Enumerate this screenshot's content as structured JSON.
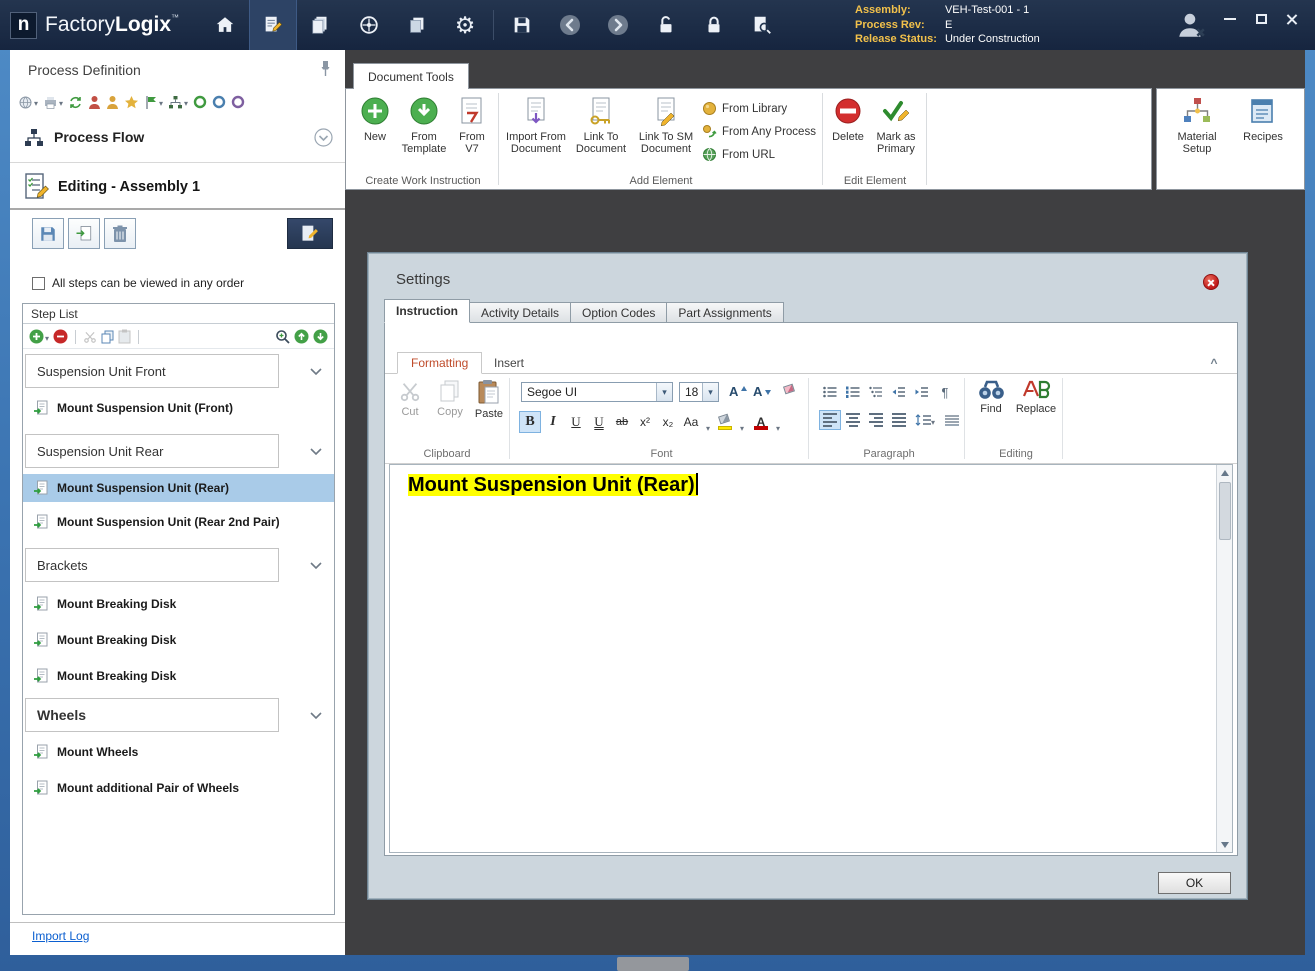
{
  "colors": {
    "titlebar_bg": "#1b2b47",
    "accent_yellow": "#f2c14b",
    "frame_blue": "#3a72b0",
    "selection_blue": "#a9cbe8",
    "highlight_yellow": "#ffff00",
    "main_bg": "#3f3f41",
    "dialog_bg": "#ccd6dd",
    "formatting_tab_text": "#bf4b2a"
  },
  "titlebar": {
    "logo_letter": "n",
    "brand_light": "Factory",
    "brand_bold": "Logix",
    "tm": "™",
    "info": {
      "assembly_label": "Assembly:",
      "assembly_value": "VEH-Test-001 - 1",
      "process_rev_label": "Process Rev:",
      "process_rev_value": "E",
      "release_label": "Release Status:",
      "release_value": "Under Construction"
    }
  },
  "sidebar": {
    "title": "Process Definition",
    "process_flow": "Process Flow",
    "editing_title": "Editing - Assembly 1",
    "order_checkbox": "All steps can be viewed in any order",
    "step_list_title": "Step List",
    "groups": [
      {
        "label": "Suspension Unit Front",
        "steps": [
          "Mount Suspension Unit (Front)"
        ]
      },
      {
        "label": "Suspension Unit Rear",
        "steps": [
          "Mount Suspension Unit (Rear)",
          "Mount Suspension Unit (Rear 2nd Pair)"
        ]
      },
      {
        "label": "Brackets",
        "steps": [
          "Mount Breaking Disk",
          "Mount Breaking Disk",
          "Mount Breaking Disk"
        ]
      },
      {
        "label": "Wheels",
        "steps": [
          "Mount Wheels",
          "Mount additional Pair of Wheels"
        ]
      }
    ],
    "import_log": "Import Log"
  },
  "ribbon": {
    "tab": "Document Tools",
    "create": {
      "label": "Create Work Instruction",
      "new": "New",
      "from_template": "From Template",
      "from_v7": "From V7"
    },
    "add": {
      "label": "Add Element",
      "import_from_document": "Import From Document",
      "link_to_document": "Link To Document",
      "link_to_sm_document": "Link To SM Document",
      "from_library": "From Library",
      "from_any_process": "From Any Process",
      "from_url": "From URL"
    },
    "edit": {
      "label": "Edit Element",
      "delete": "Delete",
      "mark_as_primary": "Mark as Primary"
    },
    "material_setup": "Material Setup",
    "recipes": "Recipes"
  },
  "dialog": {
    "title": "Settings",
    "tabs": [
      "Instruction",
      "Activity Details",
      "Option Codes",
      "Part Assignments"
    ],
    "editor": {
      "tabs": [
        "Formatting",
        "Insert"
      ],
      "clipboard": {
        "label": "Clipboard",
        "cut": "Cut",
        "copy": "Copy",
        "paste": "Paste"
      },
      "font": {
        "label": "Font",
        "family": "Segoe UI",
        "size": "18"
      },
      "paragraph": {
        "label": "Paragraph"
      },
      "editing": {
        "label": "Editing",
        "find": "Find",
        "replace": "Replace"
      },
      "content": "Mount Suspension Unit (Rear)"
    },
    "ok": "OK"
  }
}
